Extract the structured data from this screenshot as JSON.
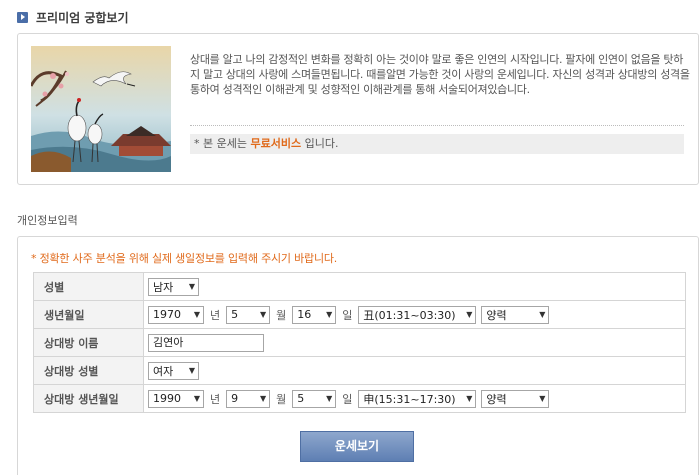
{
  "header": {
    "title": "프리미엄 궁합보기"
  },
  "intro": {
    "paragraph": "상대를 알고 나의 감정적인 변화를 정확히 아는 것이야 말로 좋은 인연의 시작입니다. 팔자에 인연이 없음을 탓하지 말고 상대의 사랑에 스며들면됩니다. 때를알면 가능한 것이 사랑의 운세입니다. 자신의 성격과 상대방의 성격을 통하여 성격적인 이해관계 및 성향적인 이해관계를 통해 서술되어져있습니다.",
    "notice_prefix": "* 본 운세는 ",
    "notice_highlight": "무료서비스",
    "notice_suffix": " 입니다."
  },
  "section_label": "개인정보입력",
  "form": {
    "hint": "* 정확한 사주 분석을 위해 실제 생일정보를 입력해 주시기 바랍니다.",
    "gender": {
      "label": "성별",
      "value": "남자"
    },
    "birth": {
      "label": "생년월일",
      "year": "1970",
      "year_unit": "년",
      "month": "5",
      "month_unit": "월",
      "day": "16",
      "day_unit": "일",
      "hour": "丑(01:31~03:30)",
      "calendar": "양력"
    },
    "partner_name": {
      "label": "상대방 이름",
      "value": "김연아"
    },
    "partner_gender": {
      "label": "상대방 성별",
      "value": "여자"
    },
    "partner_birth": {
      "label": "상대방 생년월일",
      "year": "1990",
      "year_unit": "년",
      "month": "9",
      "month_unit": "월",
      "day": "5",
      "day_unit": "일",
      "hour": "申(15:31~17:30)",
      "calendar": "양력"
    },
    "submit_label": "운세보기"
  },
  "icons": {
    "dropdown": "chevron-down-icon",
    "title": "play-icon"
  }
}
